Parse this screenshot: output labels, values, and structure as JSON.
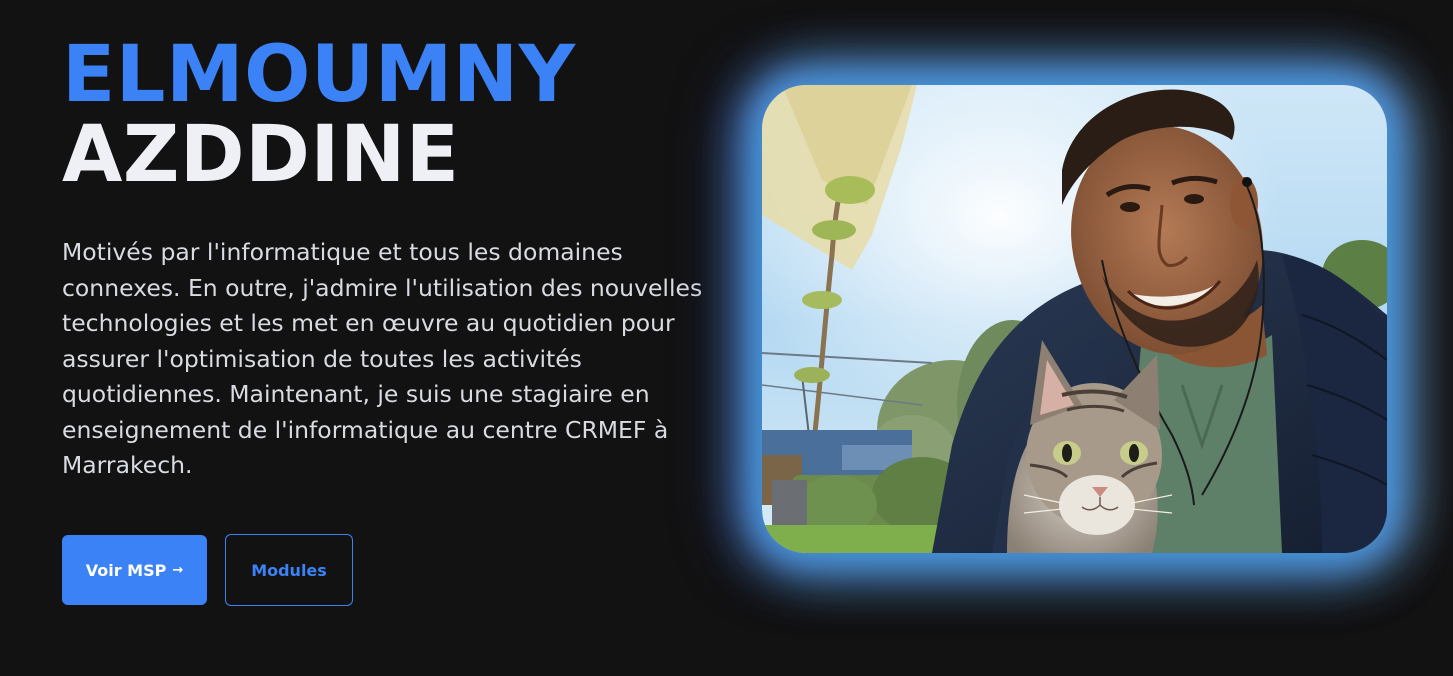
{
  "hero": {
    "first_name": "ELMOUMNY",
    "last_name": "AZDDINE",
    "bio": "Motivés par l'informatique et tous les domaines connexes. En outre, j'admire l'utilisation des nouvelles technologies et les met en œuvre au quotidien pour assurer l'optimisation de toutes les activités quotidiennes. Maintenant, je suis une stagiaire en enseignement de l'informatique au centre CRMEF à Marrakech.",
    "buttons": {
      "primary_label": "Voir MSP",
      "primary_arrow": "→",
      "secondary_label": "Modules"
    },
    "photo": {
      "subject": "portrait-photo-man-with-cat"
    }
  },
  "colors": {
    "background": "#121212",
    "accent": "#3b82f6",
    "heading_light": "#eef0f5",
    "body_text": "#d8dbe2",
    "glow_blue": "#6366f1",
    "glow_teal": "#14b8c8"
  }
}
